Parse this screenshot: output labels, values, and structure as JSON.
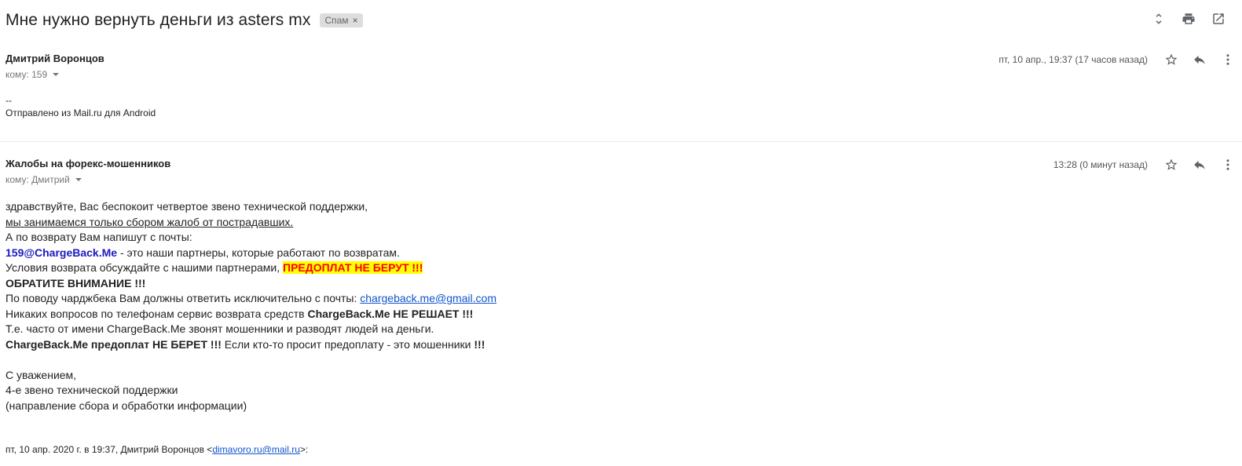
{
  "subject": "Мне нужно вернуть деньги из asters mx",
  "label": {
    "text": "Спам",
    "remove": "×"
  },
  "top_actions": [
    {
      "name": "expand-all-icon"
    },
    {
      "name": "print-icon"
    },
    {
      "name": "open-new-window-icon"
    }
  ],
  "messages": [
    {
      "sender": "Дмитрий Воронцов",
      "to": "кому: 159",
      "time": "пт, 10 апр., 19:37 (17 часов назад)",
      "body_lines": [
        "--",
        "Отправлено из Mail.ru для Android"
      ]
    },
    {
      "sender": "Жалобы на форекс-мошенников",
      "to": "кому: Дмитрий",
      "time": "13:28 (0 минут назад)",
      "body": {
        "l1": "здравствуйте, Вас беспокоит четвертое звено технической поддержки,",
        "l2": "мы занимаемся только сбором жалоб от пострадавших.",
        "l3": "А по возврату Вам напишут с почты:",
        "l4_partner": "159@ChargeBack.Me",
        "l4_rest": " - это наши партнеры, которые работают по возвратам.",
        "l5_text": "Условия возврата обсуждайте с нашими партнерами, ",
        "l5_highlight": "ПРЕДОПЛАТ НЕ БЕРУТ !!!",
        "l6": "ОБРАТИТЕ ВНИМАНИЕ !!!",
        "l7_text": "По поводу чарджбека Вам должны ответить исключительно с почты: ",
        "l7_link": "chargeback.me@gmail.com",
        "l8_text": "Никаких вопросов по телефонам сервис возврата средств ",
        "l8_bold": "ChargeBack.Me НЕ РЕШАЕТ !!!",
        "l9": "Т.е. часто от имени ChargeBack.Me звонят мошенники и разводят людей на деньги.",
        "l10_bold": "ChargeBack.Me предоплат НЕ БЕРЕТ !!!",
        "l10_text": " Если кто-то просит предоплату - это мошенники ",
        "l10_excl": "!!!",
        "sig1": "С уважением,",
        "sig2": "4-е звено технической поддержки",
        "sig3": "(направление сбора и обработки информации)"
      },
      "quote": {
        "prefix": "пт, 10 апр. 2020 г. в 19:37, Дмитрий Воронцов <",
        "email": "dimavoro.ru@mail.ru",
        "suffix": ">:"
      }
    }
  ]
}
